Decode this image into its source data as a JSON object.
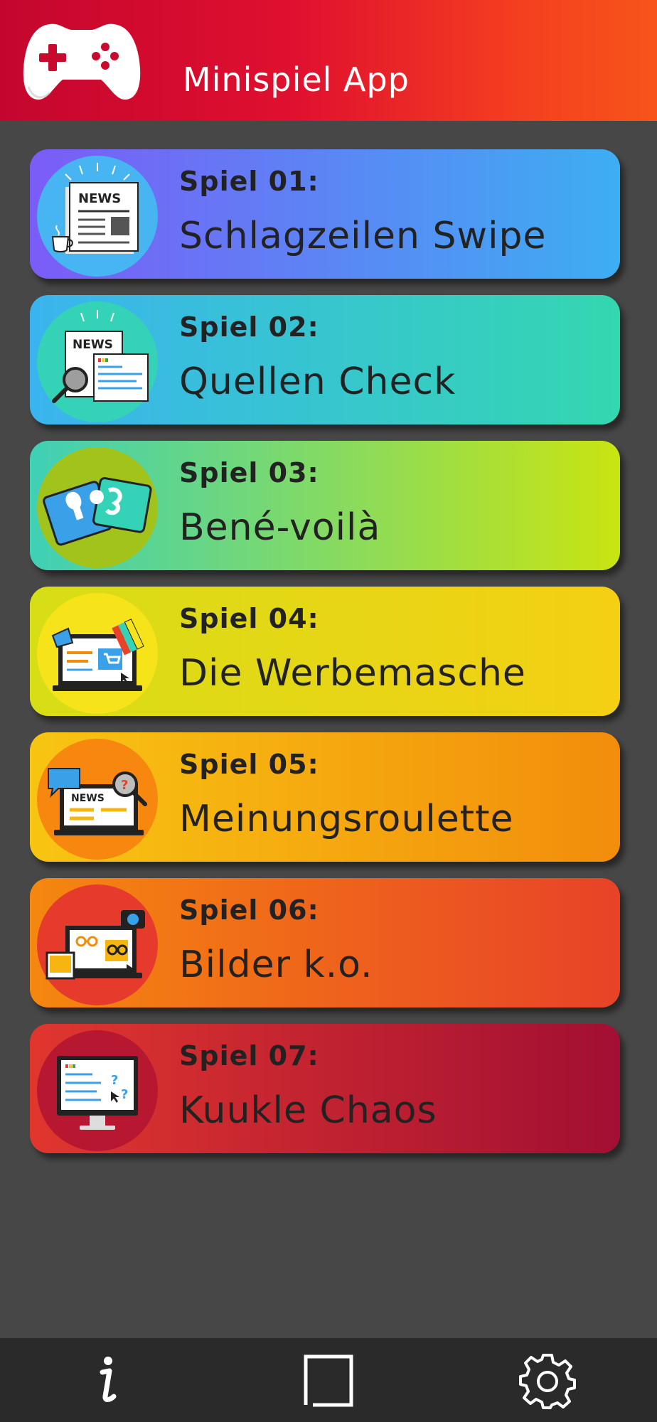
{
  "header": {
    "title": "Minispiel App",
    "logo_icon": "gamepad-icon",
    "colors": {
      "start": "#c4062e",
      "end": "#f7541a"
    }
  },
  "games": [
    {
      "number": "Spiel 01:",
      "title": "Schlagzeilen Swipe",
      "icon": "newspaper-coffee-icon",
      "gradient": [
        "#7b5cf7",
        "#3daef2"
      ],
      "icon_bg": "#46b5f2"
    },
    {
      "number": "Spiel 02:",
      "title": "Quellen Check",
      "icon": "newspaper-magnifier-icon",
      "gradient": [
        "#3ab4ee",
        "#34d7b0"
      ],
      "icon_bg": "#34d3b7"
    },
    {
      "number": "Spiel 03:",
      "title": "Bené-voilà",
      "icon": "puzzle-cards-icon",
      "gradient": [
        "#3fd0b6",
        "#c9e411"
      ],
      "icon_bg": "#a2c31b"
    },
    {
      "number": "Spiel 04:",
      "title": "Die Werbemasche",
      "icon": "laptop-shopping-icon",
      "gradient": [
        "#d7de16",
        "#f4cf14"
      ],
      "icon_bg": "#f7e31a"
    },
    {
      "number": "Spiel 05:",
      "title": "Meinungsroulette",
      "icon": "laptop-news-comment-icon",
      "gradient": [
        "#f8c512",
        "#f28d0c"
      ],
      "icon_bg": "#f7870f"
    },
    {
      "number": "Spiel 06:",
      "title": "Bilder k.o.",
      "icon": "laptop-camera-icon",
      "gradient": [
        "#f5870f",
        "#e84228"
      ],
      "icon_bg": "#e63a2d"
    },
    {
      "number": "Spiel 07:",
      "title": "Kuukle Chaos",
      "icon": "monitor-search-icon",
      "gradient": [
        "#e0362e",
        "#a20f33"
      ],
      "icon_bg": "#b81731"
    }
  ],
  "bottom_nav": [
    {
      "icon": "info-icon"
    },
    {
      "icon": "square-icon"
    },
    {
      "icon": "gear-icon"
    }
  ]
}
